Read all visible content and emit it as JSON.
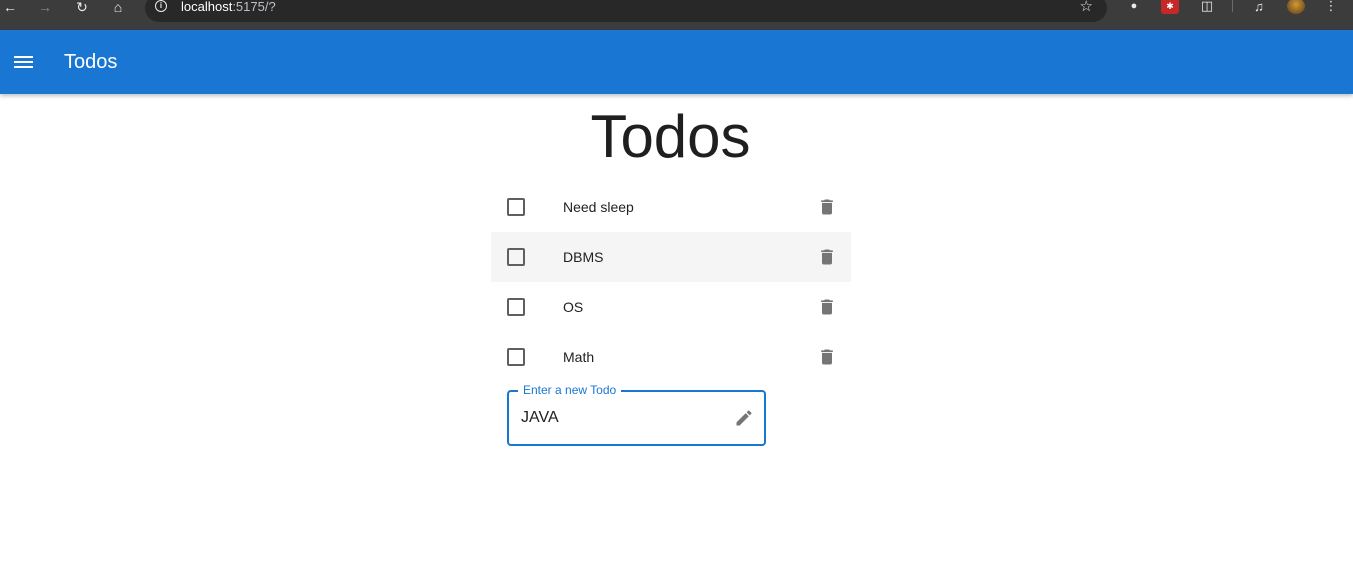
{
  "browser": {
    "url_host": "localhost",
    "url_rest": ":5175/?"
  },
  "appbar": {
    "title": "Todos"
  },
  "main": {
    "heading": "Todos",
    "todos": [
      {
        "text": "Need sleep",
        "checked": false
      },
      {
        "text": "DBMS",
        "checked": false
      },
      {
        "text": "OS",
        "checked": false
      },
      {
        "text": "Math",
        "checked": false
      }
    ],
    "new_todo": {
      "label": "Enter a new Todo",
      "value": "JAVA"
    }
  },
  "colors": {
    "primary": "#1976d2",
    "icon_gray": "#757575",
    "hover_row": "#f5f5f5"
  }
}
